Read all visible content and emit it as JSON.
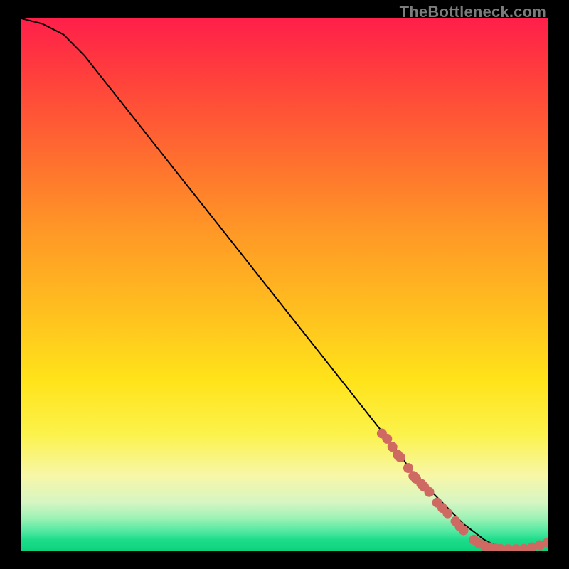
{
  "watermark": "TheBottleneck.com",
  "colors": {
    "background": "#000000",
    "curve": "#000000",
    "marker": "#cf6a62",
    "gradient_top": "#ff1f4a",
    "gradient_bottom": "#0fd27f"
  },
  "chart_data": {
    "type": "line",
    "title": "",
    "xlabel": "",
    "ylabel": "",
    "xlim": [
      0,
      100
    ],
    "ylim": [
      0,
      100
    ],
    "grid": false,
    "legend": false,
    "series": [
      {
        "name": "curve",
        "x": [
          0,
          4,
          8,
          12,
          16,
          20,
          24,
          28,
          32,
          36,
          40,
          44,
          48,
          52,
          56,
          60,
          64,
          68,
          72,
          74,
          76,
          78,
          80,
          82,
          84,
          86,
          88,
          90,
          92,
          94,
          96,
          98,
          100
        ],
        "y": [
          100,
          99,
          97,
          93,
          88,
          83,
          78,
          73,
          68,
          63,
          58,
          53,
          48,
          43,
          38,
          33,
          28,
          23,
          18,
          15,
          13,
          11,
          9,
          7,
          5,
          3.5,
          2,
          1,
          0.5,
          0.3,
          0.2,
          0.6,
          1.5
        ]
      }
    ],
    "markers": [
      {
        "x": 68.5,
        "y": 22.0
      },
      {
        "x": 69.5,
        "y": 21.0
      },
      {
        "x": 70.5,
        "y": 19.5
      },
      {
        "x": 71.5,
        "y": 18.0
      },
      {
        "x": 72.0,
        "y": 17.5
      },
      {
        "x": 73.5,
        "y": 15.5
      },
      {
        "x": 74.5,
        "y": 14.0
      },
      {
        "x": 75.0,
        "y": 13.5
      },
      {
        "x": 76.0,
        "y": 12.5
      },
      {
        "x": 76.5,
        "y": 12.0
      },
      {
        "x": 77.5,
        "y": 11.0
      },
      {
        "x": 79.0,
        "y": 9.0
      },
      {
        "x": 80.0,
        "y": 8.0
      },
      {
        "x": 81.0,
        "y": 7.0
      },
      {
        "x": 82.5,
        "y": 5.5
      },
      {
        "x": 83.3,
        "y": 4.5
      },
      {
        "x": 84.0,
        "y": 3.8
      },
      {
        "x": 86.0,
        "y": 2.0
      },
      {
        "x": 87.0,
        "y": 1.3
      },
      {
        "x": 88.0,
        "y": 0.9
      },
      {
        "x": 89.0,
        "y": 0.6
      },
      {
        "x": 90.0,
        "y": 0.4
      },
      {
        "x": 91.0,
        "y": 0.3
      },
      {
        "x": 92.5,
        "y": 0.25
      },
      {
        "x": 94.0,
        "y": 0.25
      },
      {
        "x": 95.5,
        "y": 0.3
      },
      {
        "x": 97.0,
        "y": 0.6
      },
      {
        "x": 98.5,
        "y": 1.0
      },
      {
        "x": 100.0,
        "y": 1.5
      }
    ]
  }
}
